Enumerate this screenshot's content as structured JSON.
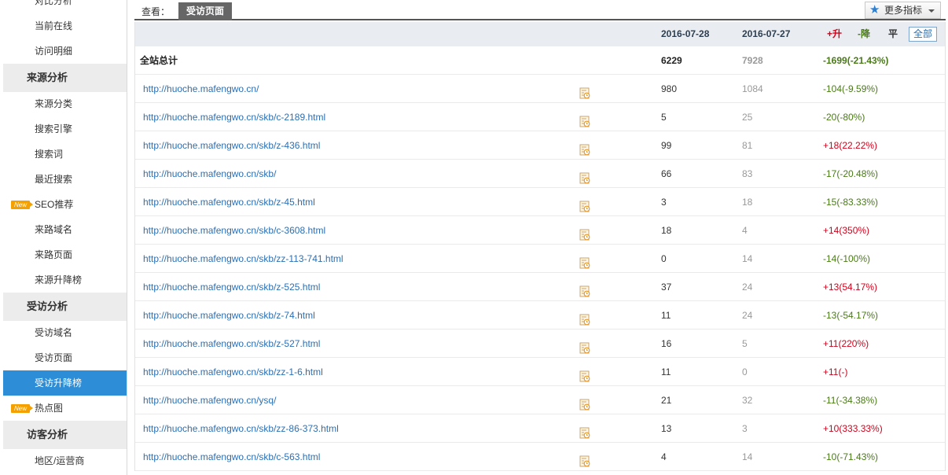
{
  "sidebar": {
    "cutoff_item": "对比分析",
    "items": [
      {
        "type": "item",
        "label": "当前在线"
      },
      {
        "type": "item",
        "label": "访问明细"
      },
      {
        "type": "group",
        "label": "来源分析"
      },
      {
        "type": "item",
        "label": "来源分类"
      },
      {
        "type": "item",
        "label": "搜索引擎"
      },
      {
        "type": "item",
        "label": "搜索词"
      },
      {
        "type": "item",
        "label": "最近搜索"
      },
      {
        "type": "item",
        "label": "SEO推荐",
        "badge": "New"
      },
      {
        "type": "item",
        "label": "来路域名"
      },
      {
        "type": "item",
        "label": "来路页面"
      },
      {
        "type": "item",
        "label": "来源升降榜"
      },
      {
        "type": "group",
        "label": "受访分析"
      },
      {
        "type": "item",
        "label": "受访域名"
      },
      {
        "type": "item",
        "label": "受访页面"
      },
      {
        "type": "item",
        "label": "受访升降榜",
        "active": true
      },
      {
        "type": "item",
        "label": "热点图",
        "badge": "New"
      },
      {
        "type": "group",
        "label": "访客分析"
      },
      {
        "type": "item",
        "label": "地区/运营商"
      }
    ]
  },
  "toolbar": {
    "view_label": "查看：",
    "active_tab": "受访页面",
    "more_metrics": "更多指标"
  },
  "table": {
    "headers": {
      "date1": "2016-07-28",
      "date2": "2016-07-27"
    },
    "filters": {
      "up": "+升",
      "down": "-降",
      "flat": "平",
      "all": "全部"
    },
    "total": {
      "label": "全站总计",
      "v1": "6229",
      "v2": "7928",
      "change": "-1699(-21.43%)"
    },
    "rows": [
      {
        "url": "http://huoche.mafengwo.cn/",
        "v1": "980",
        "v2": "1084",
        "change": "-104(-9.59%)",
        "dir": "down"
      },
      {
        "url": "http://huoche.mafengwo.cn/skb/c-2189.html",
        "v1": "5",
        "v2": "25",
        "change": "-20(-80%)",
        "dir": "down"
      },
      {
        "url": "http://huoche.mafengwo.cn/skb/z-436.html",
        "v1": "99",
        "v2": "81",
        "change": "+18(22.22%)",
        "dir": "up"
      },
      {
        "url": "http://huoche.mafengwo.cn/skb/",
        "v1": "66",
        "v2": "83",
        "change": "-17(-20.48%)",
        "dir": "down"
      },
      {
        "url": "http://huoche.mafengwo.cn/skb/z-45.html",
        "v1": "3",
        "v2": "18",
        "change": "-15(-83.33%)",
        "dir": "down"
      },
      {
        "url": "http://huoche.mafengwo.cn/skb/c-3608.html",
        "v1": "18",
        "v2": "4",
        "change": "+14(350%)",
        "dir": "up"
      },
      {
        "url": "http://huoche.mafengwo.cn/skb/zz-113-741.html",
        "v1": "0",
        "v2": "14",
        "change": "-14(-100%)",
        "dir": "down"
      },
      {
        "url": "http://huoche.mafengwo.cn/skb/z-525.html",
        "v1": "37",
        "v2": "24",
        "change": "+13(54.17%)",
        "dir": "up"
      },
      {
        "url": "http://huoche.mafengwo.cn/skb/z-74.html",
        "v1": "11",
        "v2": "24",
        "change": "-13(-54.17%)",
        "dir": "down"
      },
      {
        "url": "http://huoche.mafengwo.cn/skb/z-527.html",
        "v1": "16",
        "v2": "5",
        "change": "+11(220%)",
        "dir": "up"
      },
      {
        "url": "http://huoche.mafengwo.cn/skb/zz-1-6.html",
        "v1": "11",
        "v2": "0",
        "change": "+11(-)",
        "dir": "up"
      },
      {
        "url": "http://huoche.mafengwo.cn/ysq/",
        "v1": "21",
        "v2": "32",
        "change": "-11(-34.38%)",
        "dir": "down"
      },
      {
        "url": "http://huoche.mafengwo.cn/skb/zz-86-373.html",
        "v1": "13",
        "v2": "3",
        "change": "+10(333.33%)",
        "dir": "up"
      },
      {
        "url": "http://huoche.mafengwo.cn/skb/c-563.html",
        "v1": "4",
        "v2": "14",
        "change": "-10(-71.43%)",
        "dir": "down"
      }
    ]
  },
  "colors": {
    "accent": "#2d8dd6",
    "up": "#d0021b",
    "down": "#4a7a19",
    "link": "#2b6fb3"
  }
}
